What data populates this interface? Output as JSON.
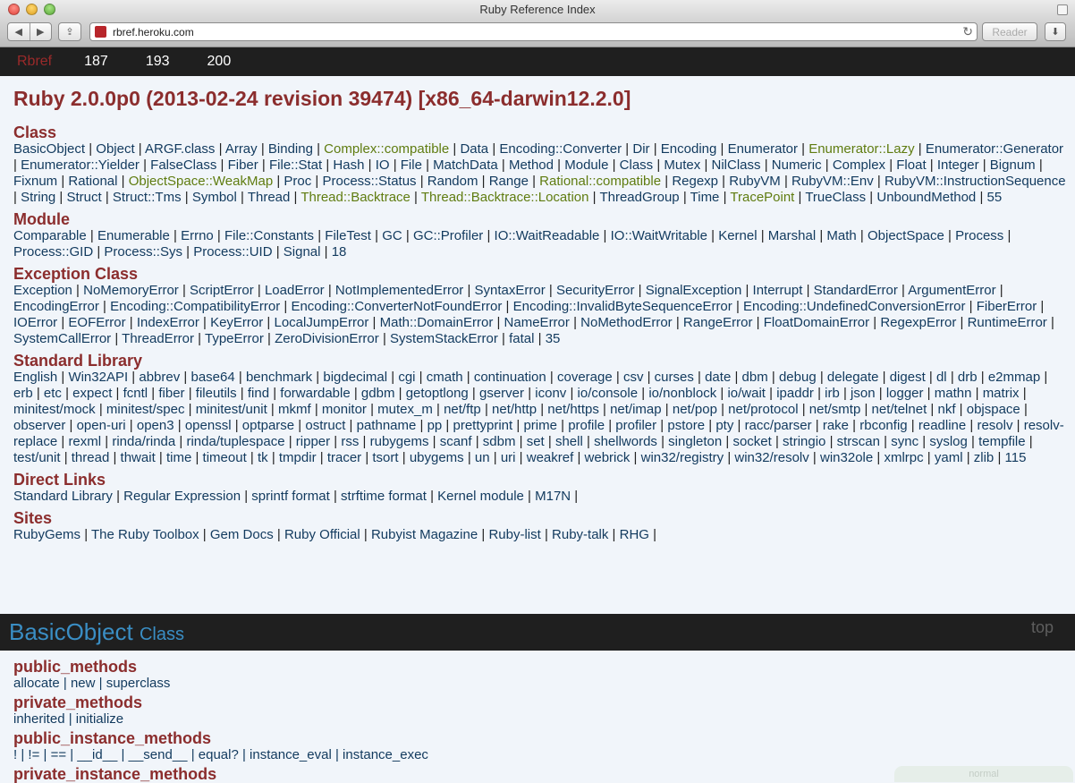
{
  "window": {
    "title": "Ruby Reference Index"
  },
  "toolbar": {
    "url": "rbref.heroku.com",
    "reader_label": "Reader"
  },
  "topnav": {
    "brand": "Rbref",
    "versions": [
      "187",
      "193",
      "200"
    ]
  },
  "page_title": "Ruby 2.0.0p0 (2013-02-24 revision 39474) [x86_64-darwin12.2.0]",
  "sections": [
    {
      "title": "Class",
      "items": [
        {
          "t": "BasicObject"
        },
        {
          "t": "Object"
        },
        {
          "t": "ARGF.class"
        },
        {
          "t": "Array"
        },
        {
          "t": "Binding"
        },
        {
          "t": "Complex::compatible",
          "g": true
        },
        {
          "t": "Data"
        },
        {
          "t": "Encoding::Converter"
        },
        {
          "t": "Dir"
        },
        {
          "t": "Encoding"
        },
        {
          "t": "Enumerator"
        },
        {
          "t": "Enumerator::Lazy",
          "g": true
        },
        {
          "t": "Enumerator::Generator"
        },
        {
          "t": "Enumerator::Yielder"
        },
        {
          "t": "FalseClass"
        },
        {
          "t": "Fiber"
        },
        {
          "t": "File::Stat"
        },
        {
          "t": "Hash"
        },
        {
          "t": "IO"
        },
        {
          "t": "File"
        },
        {
          "t": "MatchData"
        },
        {
          "t": "Method"
        },
        {
          "t": "Module"
        },
        {
          "t": "Class"
        },
        {
          "t": "Mutex"
        },
        {
          "t": "NilClass"
        },
        {
          "t": "Numeric"
        },
        {
          "t": "Complex"
        },
        {
          "t": "Float"
        },
        {
          "t": "Integer"
        },
        {
          "t": "Bignum"
        },
        {
          "t": "Fixnum"
        },
        {
          "t": "Rational"
        },
        {
          "t": "ObjectSpace::WeakMap",
          "g": true
        },
        {
          "t": "Proc"
        },
        {
          "t": "Process::Status"
        },
        {
          "t": "Random"
        },
        {
          "t": "Range"
        },
        {
          "t": "Rational::compatible",
          "g": true
        },
        {
          "t": "Regexp"
        },
        {
          "t": "RubyVM"
        },
        {
          "t": "RubyVM::Env"
        },
        {
          "t": "RubyVM::InstructionSequence"
        },
        {
          "t": "String"
        },
        {
          "t": "Struct"
        },
        {
          "t": "Struct::Tms"
        },
        {
          "t": "Symbol"
        },
        {
          "t": "Thread"
        },
        {
          "t": "Thread::Backtrace",
          "g": true
        },
        {
          "t": "Thread::Backtrace::Location",
          "g": true
        },
        {
          "t": "ThreadGroup"
        },
        {
          "t": "Time"
        },
        {
          "t": "TracePoint",
          "g": true
        },
        {
          "t": "TrueClass"
        },
        {
          "t": "UnboundMethod"
        }
      ],
      "count": "55"
    },
    {
      "title": "Module",
      "items": [
        {
          "t": "Comparable"
        },
        {
          "t": "Enumerable"
        },
        {
          "t": "Errno"
        },
        {
          "t": "File::Constants"
        },
        {
          "t": "FileTest"
        },
        {
          "t": "GC"
        },
        {
          "t": "GC::Profiler"
        },
        {
          "t": "IO::WaitReadable"
        },
        {
          "t": "IO::WaitWritable"
        },
        {
          "t": "Kernel"
        },
        {
          "t": "Marshal"
        },
        {
          "t": "Math"
        },
        {
          "t": "ObjectSpace"
        },
        {
          "t": "Process"
        },
        {
          "t": "Process::GID"
        },
        {
          "t": "Process::Sys"
        },
        {
          "t": "Process::UID"
        },
        {
          "t": "Signal"
        }
      ],
      "count": "18"
    },
    {
      "title": "Exception Class",
      "items": [
        {
          "t": "Exception"
        },
        {
          "t": "NoMemoryError"
        },
        {
          "t": "ScriptError"
        },
        {
          "t": "LoadError"
        },
        {
          "t": "NotImplementedError"
        },
        {
          "t": "SyntaxError"
        },
        {
          "t": "SecurityError"
        },
        {
          "t": "SignalException"
        },
        {
          "t": "Interrupt"
        },
        {
          "t": "StandardError"
        },
        {
          "t": "ArgumentError"
        },
        {
          "t": "EncodingError"
        },
        {
          "t": "Encoding::CompatibilityError"
        },
        {
          "t": "Encoding::ConverterNotFoundError"
        },
        {
          "t": "Encoding::InvalidByteSequenceError"
        },
        {
          "t": "Encoding::UndefinedConversionError"
        },
        {
          "t": "FiberError"
        },
        {
          "t": "IOError"
        },
        {
          "t": "EOFError"
        },
        {
          "t": "IndexError"
        },
        {
          "t": "KeyError"
        },
        {
          "t": "LocalJumpError"
        },
        {
          "t": "Math::DomainError"
        },
        {
          "t": "NameError"
        },
        {
          "t": "NoMethodError"
        },
        {
          "t": "RangeError"
        },
        {
          "t": "FloatDomainError"
        },
        {
          "t": "RegexpError"
        },
        {
          "t": "RuntimeError"
        },
        {
          "t": "SystemCallError"
        },
        {
          "t": "ThreadError"
        },
        {
          "t": "TypeError"
        },
        {
          "t": "ZeroDivisionError"
        },
        {
          "t": "SystemStackError"
        },
        {
          "t": "fatal"
        }
      ],
      "count": "35"
    },
    {
      "title": "Standard Library",
      "items": [
        {
          "t": "English"
        },
        {
          "t": "Win32API"
        },
        {
          "t": "abbrev"
        },
        {
          "t": "base64"
        },
        {
          "t": "benchmark"
        },
        {
          "t": "bigdecimal"
        },
        {
          "t": "cgi"
        },
        {
          "t": "cmath"
        },
        {
          "t": "continuation"
        },
        {
          "t": "coverage"
        },
        {
          "t": "csv"
        },
        {
          "t": "curses"
        },
        {
          "t": "date"
        },
        {
          "t": "dbm"
        },
        {
          "t": "debug"
        },
        {
          "t": "delegate"
        },
        {
          "t": "digest"
        },
        {
          "t": "dl"
        },
        {
          "t": "drb"
        },
        {
          "t": "e2mmap"
        },
        {
          "t": "erb"
        },
        {
          "t": "etc"
        },
        {
          "t": "expect"
        },
        {
          "t": "fcntl"
        },
        {
          "t": "fiber"
        },
        {
          "t": "fileutils"
        },
        {
          "t": "find"
        },
        {
          "t": "forwardable"
        },
        {
          "t": "gdbm"
        },
        {
          "t": "getoptlong"
        },
        {
          "t": "gserver"
        },
        {
          "t": "iconv"
        },
        {
          "t": "io/console"
        },
        {
          "t": "io/nonblock"
        },
        {
          "t": "io/wait"
        },
        {
          "t": "ipaddr"
        },
        {
          "t": "irb"
        },
        {
          "t": "json"
        },
        {
          "t": "logger"
        },
        {
          "t": "mathn"
        },
        {
          "t": "matrix"
        },
        {
          "t": "minitest/mock"
        },
        {
          "t": "minitest/spec"
        },
        {
          "t": "minitest/unit"
        },
        {
          "t": "mkmf"
        },
        {
          "t": "monitor"
        },
        {
          "t": "mutex_m"
        },
        {
          "t": "net/ftp"
        },
        {
          "t": "net/http"
        },
        {
          "t": "net/https"
        },
        {
          "t": "net/imap"
        },
        {
          "t": "net/pop"
        },
        {
          "t": "net/protocol"
        },
        {
          "t": "net/smtp"
        },
        {
          "t": "net/telnet"
        },
        {
          "t": "nkf"
        },
        {
          "t": "objspace"
        },
        {
          "t": "observer"
        },
        {
          "t": "open-uri"
        },
        {
          "t": "open3"
        },
        {
          "t": "openssl"
        },
        {
          "t": "optparse"
        },
        {
          "t": "ostruct"
        },
        {
          "t": "pathname"
        },
        {
          "t": "pp"
        },
        {
          "t": "prettyprint"
        },
        {
          "t": "prime"
        },
        {
          "t": "profile"
        },
        {
          "t": "profiler"
        },
        {
          "t": "pstore"
        },
        {
          "t": "pty"
        },
        {
          "t": "racc/parser"
        },
        {
          "t": "rake"
        },
        {
          "t": "rbconfig"
        },
        {
          "t": "readline"
        },
        {
          "t": "resolv"
        },
        {
          "t": "resolv-replace"
        },
        {
          "t": "rexml"
        },
        {
          "t": "rinda/rinda"
        },
        {
          "t": "rinda/tuplespace"
        },
        {
          "t": "ripper"
        },
        {
          "t": "rss"
        },
        {
          "t": "rubygems"
        },
        {
          "t": "scanf"
        },
        {
          "t": "sdbm"
        },
        {
          "t": "set"
        },
        {
          "t": "shell"
        },
        {
          "t": "shellwords"
        },
        {
          "t": "singleton"
        },
        {
          "t": "socket"
        },
        {
          "t": "stringio"
        },
        {
          "t": "strscan"
        },
        {
          "t": "sync"
        },
        {
          "t": "syslog"
        },
        {
          "t": "tempfile"
        },
        {
          "t": "test/unit"
        },
        {
          "t": "thread"
        },
        {
          "t": "thwait"
        },
        {
          "t": "time"
        },
        {
          "t": "timeout"
        },
        {
          "t": "tk"
        },
        {
          "t": "tmpdir"
        },
        {
          "t": "tracer"
        },
        {
          "t": "tsort"
        },
        {
          "t": "ubygems"
        },
        {
          "t": "un"
        },
        {
          "t": "uri"
        },
        {
          "t": "weakref"
        },
        {
          "t": "webrick"
        },
        {
          "t": "win32/registry"
        },
        {
          "t": "win32/resolv"
        },
        {
          "t": "win32ole"
        },
        {
          "t": "xmlrpc"
        },
        {
          "t": "yaml"
        },
        {
          "t": "zlib"
        }
      ],
      "count": "115"
    },
    {
      "title": "Direct Links",
      "items": [
        {
          "t": "Standard Library"
        },
        {
          "t": "Regular Expression"
        },
        {
          "t": "sprintf format"
        },
        {
          "t": "strftime format"
        },
        {
          "t": "Kernel module"
        },
        {
          "t": "M17N"
        }
      ],
      "trailing_sep": true
    },
    {
      "title": "Sites",
      "items": [
        {
          "t": "RubyGems"
        },
        {
          "t": "The Ruby Toolbox"
        },
        {
          "t": "Gem Docs"
        },
        {
          "t": "Ruby Official"
        },
        {
          "t": "Rubyist Magazine"
        },
        {
          "t": "Ruby-list"
        },
        {
          "t": "Ruby-talk"
        },
        {
          "t": "RHG"
        }
      ],
      "trailing_sep": true
    }
  ],
  "class_header": {
    "name": "BasicObject",
    "type": "Class",
    "top_link": "top"
  },
  "method_groups": [
    {
      "title": "public_methods",
      "items": [
        "allocate",
        "new",
        "superclass"
      ]
    },
    {
      "title": "private_methods",
      "items": [
        "inherited",
        "initialize"
      ]
    },
    {
      "title": "public_instance_methods",
      "items": [
        "!",
        "!=",
        "==",
        "__id__",
        "__send__",
        "equal?",
        "instance_eval",
        "instance_exec"
      ]
    },
    {
      "title": "private_instance_methods",
      "items": []
    }
  ],
  "status_pill": "normal"
}
